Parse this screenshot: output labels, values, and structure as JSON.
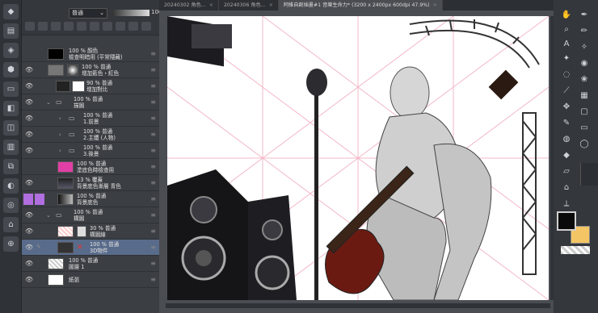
{
  "layer_panel": {
    "blend_mode": "普通",
    "opacity": "100",
    "layers": [
      {
        "opacity": "100 %",
        "mode": "顏色",
        "name": "檢查明暗用 (平常隱藏)",
        "thumb": "black"
      },
      {
        "opacity": "100 %",
        "mode": "普通",
        "name": "增加藍色・紅色",
        "thumb": "mask"
      },
      {
        "opacity": "90 %",
        "mode": "普通",
        "name": "增加對比",
        "thumb": "mask2"
      },
      {
        "opacity": "100 %",
        "mode": "普通",
        "name": "描圖",
        "thumb": "folder"
      },
      {
        "opacity": "100 %",
        "mode": "普通",
        "name": "1.前景",
        "thumb": "folder"
      },
      {
        "opacity": "100 %",
        "mode": "普通",
        "name": "2.主體 (人物)",
        "thumb": "folder"
      },
      {
        "opacity": "100 %",
        "mode": "普通",
        "name": "3.後景",
        "thumb": "folder"
      },
      {
        "opacity": "100 %",
        "mode": "普通",
        "name": "塗底色時檢查用",
        "thumb": "pink"
      },
      {
        "opacity": "13 %",
        "mode": "覆蓋",
        "name": "背景底色漸層 青色",
        "thumb": "blue"
      },
      {
        "opacity": "100 %",
        "mode": "普通",
        "name": "背景底色",
        "thumb": "gray"
      },
      {
        "opacity": "100 %",
        "mode": "普通",
        "name": "構圖",
        "thumb": "folder"
      },
      {
        "opacity": "30 %",
        "mode": "普通",
        "name": "構圖線",
        "thumb": "grid"
      },
      {
        "opacity": "100 %",
        "mode": "普通",
        "name": "3D物件",
        "thumb": "3d"
      },
      {
        "opacity": "100 %",
        "mode": "普通",
        "name": "圖層 1",
        "thumb": "check"
      },
      {
        "opacity": "",
        "mode": "",
        "name": "紙張",
        "thumb": "white"
      }
    ]
  },
  "tabs": [
    {
      "label": "20240302 角色...",
      "active": false
    },
    {
      "label": "20240306 角色...",
      "active": false
    },
    {
      "label": "阿維自創插畫#1 音樂生命力* (3200 x 2400px 600dpi 47.9%)",
      "active": true
    }
  ],
  "colors": {
    "foreground": "#0a0a0a",
    "background": "#f4c565",
    "selection": "#596b8a"
  }
}
